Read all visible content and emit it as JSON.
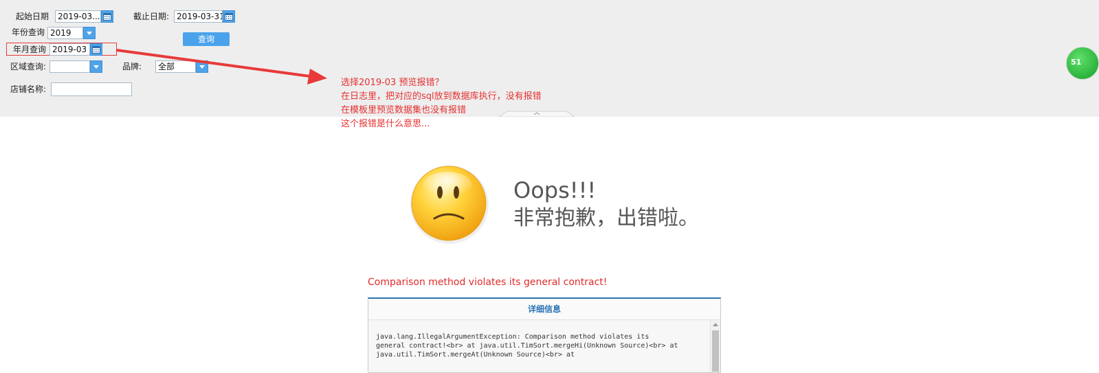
{
  "params": {
    "start_date_label": "起始日期",
    "start_date_value": "2019-03...",
    "end_date_label": "截止日期:",
    "end_date_value": "2019-03-31",
    "year_label": "年份查询",
    "year_value": "2019",
    "query_button": "查询",
    "month_label": "年月查询",
    "month_value": "2019-03",
    "region_label": "区域查询:",
    "region_value": "",
    "brand_label": "品牌:",
    "brand_value": "全部",
    "store_label": "店铺名称:",
    "store_value": ""
  },
  "annotation": {
    "lines": [
      "选择2019-03 预览报错？",
      "在日志里，把对应的sql放到数据库执行，没有报错",
      "在模板里预览数据集也没有报错",
      "这个报错是什么意思..."
    ],
    "color": "#e53030"
  },
  "badge_text": "51",
  "error": {
    "oops": "Oops!!!",
    "sorry": "非常抱歉，出错啦。",
    "message": "Comparison method violates its general contract!",
    "detail_title": "详细信息",
    "stack_trace": "java.lang.IllegalArgumentException: Comparison method violates its general contract!<br> at java.util.TimSort.mergeHi(Unknown Source)<br> at java.util.TimSort.mergeAt(Unknown Source)<br> at"
  },
  "colors": {
    "panel_bg": "#eeeeee",
    "accent_blue": "#4aa3ea",
    "error_red": "#e02a2a",
    "detail_title_blue": "#2a72b5"
  }
}
